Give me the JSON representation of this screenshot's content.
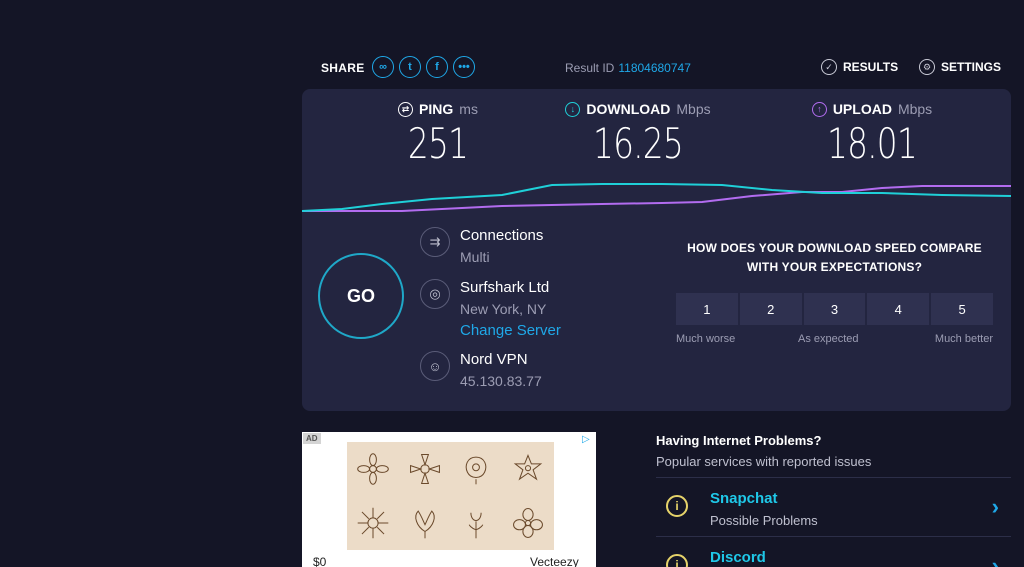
{
  "topbar": {
    "share_label": "SHARE",
    "share_icons": [
      "link-icon",
      "twitter-icon",
      "facebook-icon",
      "more-icon"
    ],
    "result_id_label": "Result ID",
    "result_id": "11804680747",
    "results_label": "RESULTS",
    "settings_label": "SETTINGS"
  },
  "metrics": {
    "ping": {
      "label": "PING",
      "unit": "ms",
      "value": "251"
    },
    "download": {
      "label": "DOWNLOAD",
      "unit": "Mbps",
      "value": "16.25"
    },
    "upload": {
      "label": "UPLOAD",
      "unit": "Mbps",
      "value": "18.01"
    }
  },
  "go_label": "GO",
  "connections": {
    "title": "Connections",
    "value": "Multi"
  },
  "server": {
    "name": "Surfshark Ltd",
    "location": "New York, NY",
    "change_link": "Change Server"
  },
  "provider": {
    "name": "Nord VPN",
    "ip": "45.130.83.77"
  },
  "survey": {
    "question_line1": "HOW DOES YOUR DOWNLOAD SPEED COMPARE",
    "question_line2": "WITH YOUR EXPECTATIONS?",
    "options": [
      "1",
      "2",
      "3",
      "4",
      "5"
    ],
    "label_left": "Much worse",
    "label_mid": "As expected",
    "label_right": "Much better"
  },
  "ad": {
    "badge": "AD",
    "price": "$0",
    "brand": "Vecteezy"
  },
  "problems": {
    "title": "Having Internet Problems?",
    "subtitle": "Popular services with reported issues",
    "items": [
      {
        "name": "Snapchat",
        "status": "Possible Problems"
      },
      {
        "name": "Discord",
        "status": ""
      }
    ]
  },
  "colors": {
    "background": "#141526",
    "card": "#232540",
    "download_line": "#1fd0d8",
    "upload_line": "#b26cf0",
    "accent": "#1fa8e8"
  }
}
